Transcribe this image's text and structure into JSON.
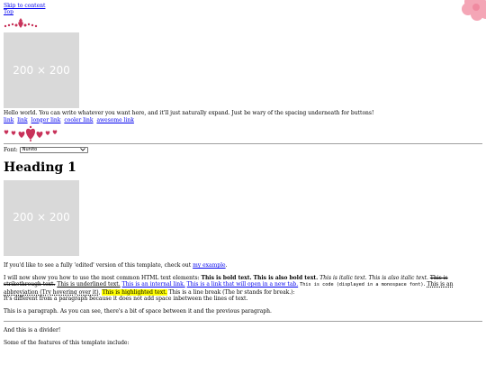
{
  "nav": {
    "skip": "Skip to content",
    "top": "Top"
  },
  "colors": {
    "flower": "#f4a6b6",
    "ornament": "#c8325a",
    "placeholder": "#d9d9d9",
    "highlight": "#ffff00"
  },
  "header": {
    "placeholder_label": "200 × 200",
    "hello": "Hello world. You can write whatever you want here, and it'll just naturally expand. Just be wary of the spacing underneath for buttons!",
    "links": [
      "link",
      "link",
      "longer link",
      "cooler link",
      "awesome link"
    ]
  },
  "font_picker": {
    "label": "Font:",
    "value": "Nunito"
  },
  "main": {
    "heading": "Heading 1",
    "placeholder_label": "200 × 200",
    "edited_text": "If you'd like to see a fully 'edited' version of this template, check out",
    "edited_link": "my example",
    "edited_end": ".",
    "intro": "I will now show you how to use the most common HTML text elements:",
    "bold1": "This is bold text.",
    "bold2": "This is also bold text.",
    "italic1": "This is italic text.",
    "italic2": "This is also italic text.",
    "strike": "This is strikethrough text.",
    "underline": "This is underlined text.",
    "internal_link": "This is an internal link.",
    "new_tab_link": "This is a link that will open in a new tab.",
    "code": "This is code (displayed in a monospace font)",
    "abbr": "This is an abbreviation (Try hovering over it)",
    "highlight": "This is highlighted text.",
    "line_break": "This is a line break (The br stands for break.):",
    "after_break": "It's different from a paragraph because it does not add space inbetween the lines of text.",
    "paragraph": "This is a paragraph. As you can see, there's a bit of space between it and the previous paragraph.",
    "divider_text": "And this is a divider!",
    "features_text": "Some of the features of this template include:"
  }
}
